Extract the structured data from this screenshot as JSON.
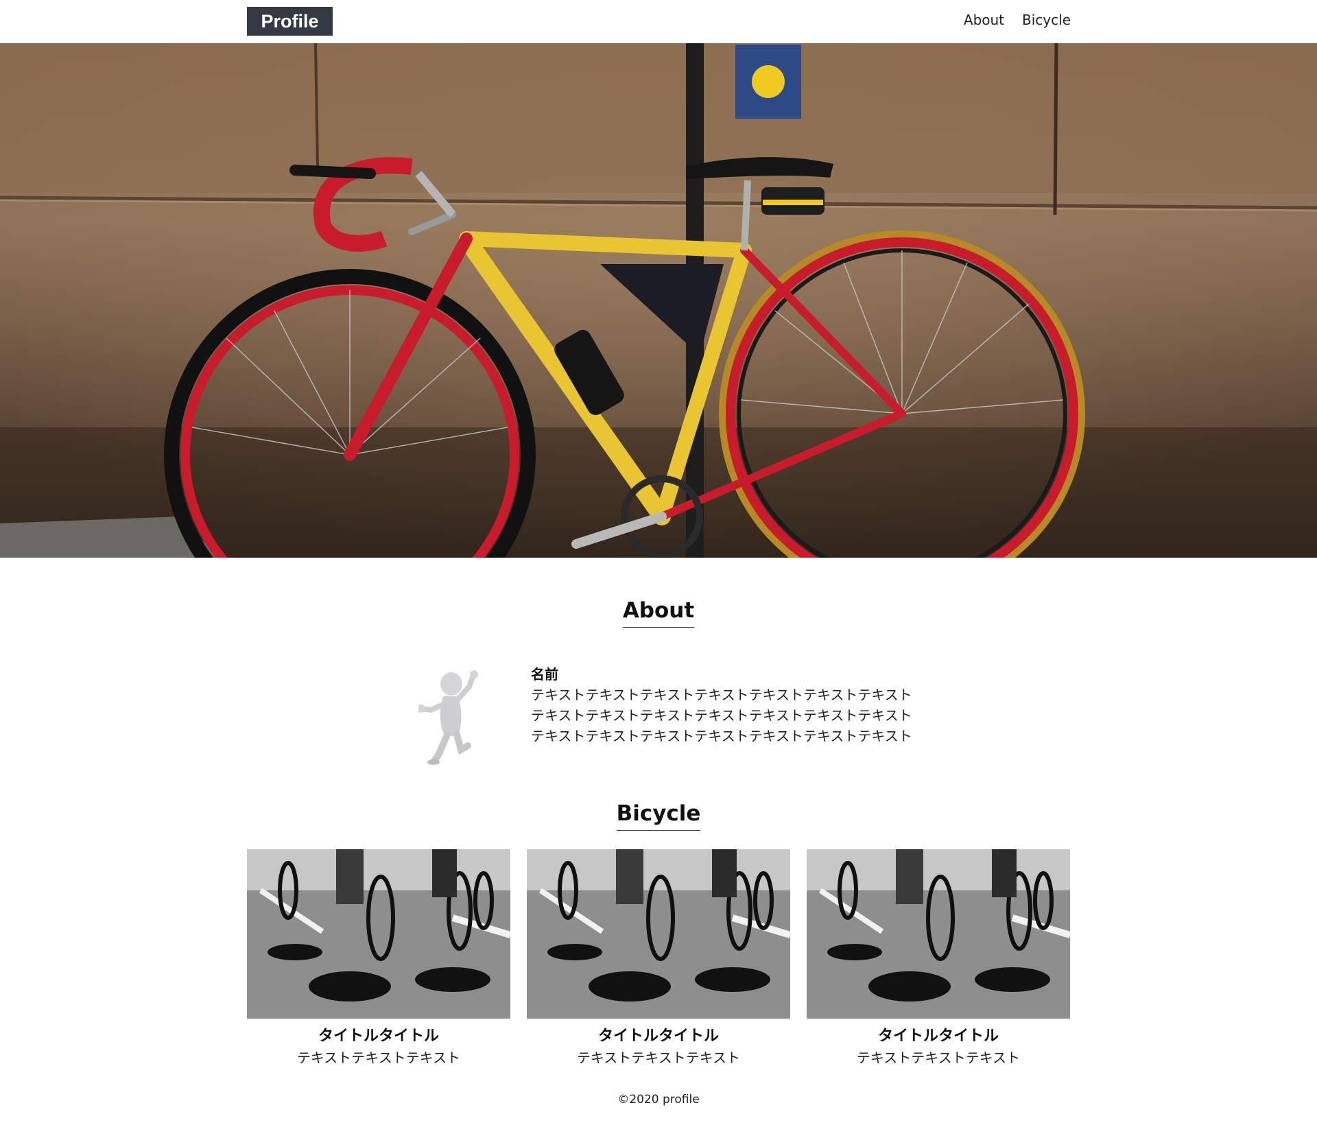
{
  "header": {
    "logo": "Profile",
    "nav": [
      {
        "label": "About"
      },
      {
        "label": "Bicycle"
      }
    ]
  },
  "hero": {
    "image": "road-bicycle-against-wall"
  },
  "about": {
    "title": "About",
    "avatar": "3d-figure-jumping",
    "name": "名前",
    "lines": [
      "テキストテキストテキストテキストテキストテキストテキスト",
      "テキストテキストテキストテキストテキストテキストテキスト",
      "テキストテキストテキストテキストテキストテキストテキスト"
    ]
  },
  "bicycle": {
    "title": "Bicycle",
    "cards": [
      {
        "title": "タイトルタイトル",
        "text": "テキストテキストテキスト",
        "image": "cyclists-race-bw"
      },
      {
        "title": "タイトルタイトル",
        "text": "テキストテキストテキスト",
        "image": "cyclists-race-bw"
      },
      {
        "title": "タイトルタイトル",
        "text": "テキストテキストテキスト",
        "image": "cyclists-race-bw"
      }
    ]
  },
  "footer": {
    "copyright": "©2020 profile"
  },
  "colors": {
    "logo_bg": "#333a44",
    "text": "#111111",
    "frame_yellow": "#e8c531",
    "frame_red": "#c91b2b"
  }
}
